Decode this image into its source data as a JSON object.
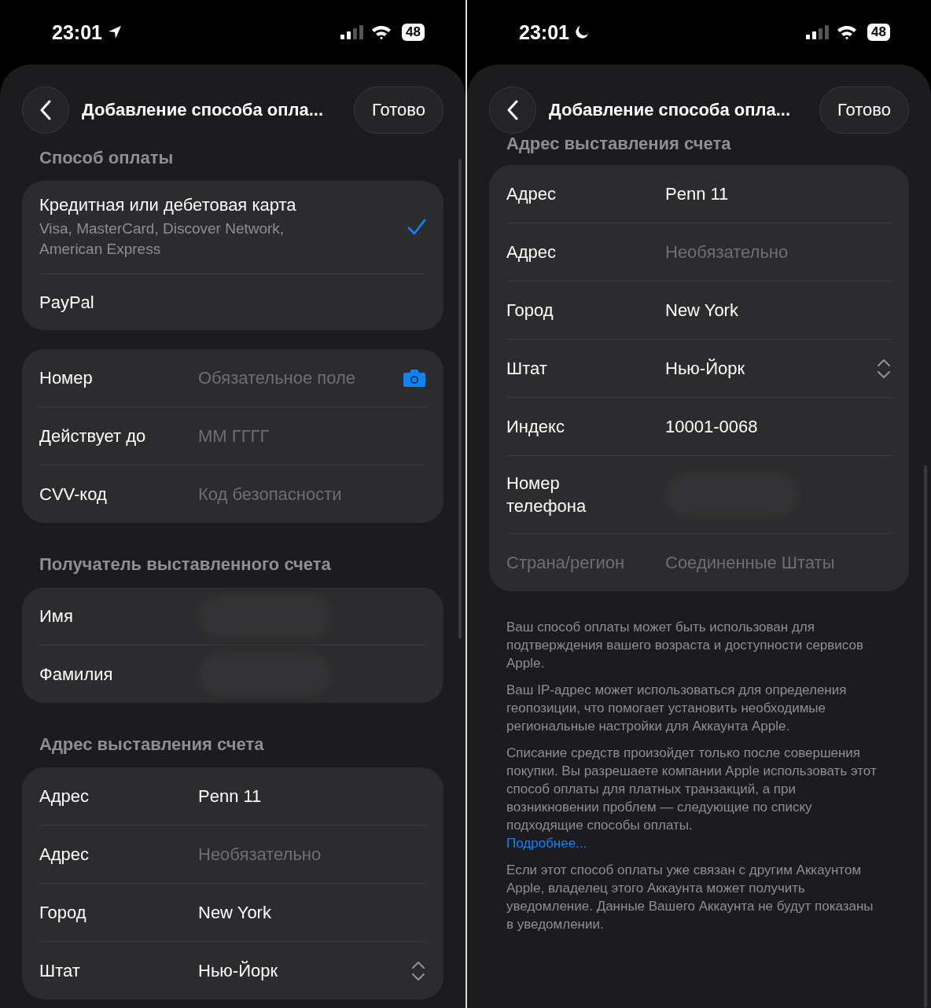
{
  "screens": [
    {
      "status_bar": {
        "time": "23:01",
        "location_active": true,
        "battery": "48"
      },
      "header": {
        "title": "Добавление способа опла...",
        "done": "Готово"
      },
      "sections": [
        {
          "title": "Способ оплаты",
          "kind": "options",
          "items": [
            {
              "title": "Кредитная или дебетовая карта",
              "subtitle": "Visa, MasterCard, Discover Network, American Express",
              "selected": true
            },
            {
              "title": "PayPal",
              "selected": false
            }
          ]
        },
        {
          "kind": "fields",
          "rows": [
            {
              "kind": "camera",
              "label": "Номер",
              "placeholder": "Обязательное поле",
              "disabled": false
            },
            {
              "kind": "text",
              "label": "Действует до",
              "placeholder": "ММ ГГГГ",
              "disabled": false
            },
            {
              "kind": "text",
              "label": "CVV-код",
              "placeholder": "Код безопасности",
              "disabled": false
            }
          ]
        },
        {
          "title": "Получатель выставленного счета",
          "kind": "fields",
          "rows": [
            {
              "kind": "hidden",
              "label": "Имя",
              "disabled": false
            },
            {
              "kind": "hidden",
              "label": "Фамилия",
              "disabled": false
            }
          ]
        },
        {
          "title": "Адрес выставления счета",
          "kind": "fields",
          "rows": [
            {
              "kind": "text",
              "label": "Адрес",
              "value": "Penn 11",
              "disabled": false
            },
            {
              "kind": "text",
              "label": "Адрес",
              "placeholder": "Необязательно",
              "disabled": false
            },
            {
              "kind": "text",
              "label": "Город",
              "value": "New York",
              "disabled": false
            },
            {
              "kind": "picker",
              "label": "Штат",
              "value": "Нью-Йорк",
              "disabled": false
            }
          ]
        }
      ]
    },
    {
      "status_bar": {
        "time": "23:01",
        "focus_active": true,
        "battery": "48"
      },
      "header": {
        "title": "Добавление способа опла...",
        "done": "Готово"
      },
      "sections": [
        {
          "title": "Адрес выставления счета",
          "kind": "fields",
          "rows": [
            {
              "kind": "text",
              "label": "Адрес",
              "value": "Penn 11",
              "disabled": false
            },
            {
              "kind": "text",
              "label": "Адрес",
              "placeholder": "Необязательно",
              "disabled": false
            },
            {
              "kind": "text",
              "label": "Город",
              "value": "New York",
              "disabled": false
            },
            {
              "kind": "picker",
              "label": "Штат",
              "value": "Нью-Йорк",
              "disabled": false
            },
            {
              "kind": "text",
              "label": "Индекс",
              "value": "10001-0068",
              "disabled": false
            },
            {
              "kind": "hidden",
              "label": "Номер телефона",
              "disabled": false
            },
            {
              "kind": "text",
              "label": "Страна/регион",
              "value": "Соединенные Штаты",
              "disabled": true
            }
          ]
        }
      ],
      "footer": [
        {
          "text": "Ваш способ оплаты может быть использован для подтверждения вашего возраста и доступности сервисов Apple."
        },
        {
          "text": "Ваш IP-адрес может использоваться для определения геопозиции, что помогает установить необходимые региональные настройки для Аккаунта Apple."
        },
        {
          "text": "Списание средств произойдет только после совершения покупки. Вы разрешаете компании Apple использовать этот способ оплаты для платных транзакций, а при возникновении проблем — следующие по списку подходящие способы оплаты.",
          "link": "Подробнее..."
        },
        {
          "text": "Если этот способ оплаты уже связан с другим Аккаунтом Apple, владелец этого Аккаунта может получить уведомление. Данные Вашего Аккаунта не будут показаны в уведомлении."
        }
      ]
    }
  ]
}
